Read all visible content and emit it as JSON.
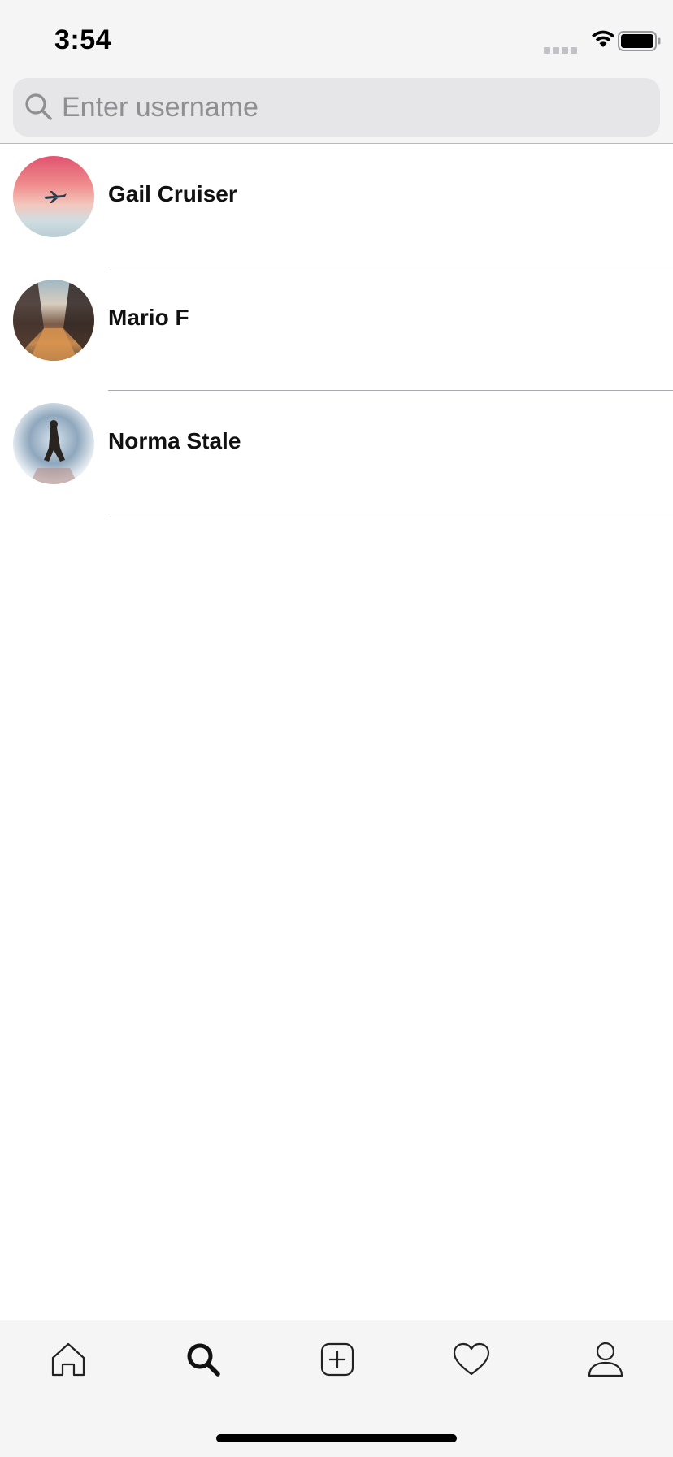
{
  "status_bar": {
    "time": "3:54",
    "icons": [
      "cellular-signal-icon",
      "wifi-icon",
      "battery-icon"
    ]
  },
  "search": {
    "placeholder": "Enter username",
    "value": "",
    "icon": "search-icon"
  },
  "users": [
    {
      "name": "Gail Cruiser",
      "avatar": "avatar-photo"
    },
    {
      "name": "Mario F",
      "avatar": "avatar-photo"
    },
    {
      "name": "Norma Stale",
      "avatar": "avatar-photo"
    }
  ],
  "tab_bar": {
    "tabs": [
      {
        "icon": "home-icon",
        "active": false
      },
      {
        "icon": "search-icon",
        "active": true
      },
      {
        "icon": "add-post-icon",
        "active": false
      },
      {
        "icon": "heart-icon",
        "active": false
      },
      {
        "icon": "profile-icon",
        "active": false
      }
    ]
  },
  "colors": {
    "background": "#ffffff",
    "chrome": "#f5f5f6",
    "search_field": "#e6e6e8",
    "placeholder": "#8e8e93",
    "divider": "#a9a9ad"
  }
}
